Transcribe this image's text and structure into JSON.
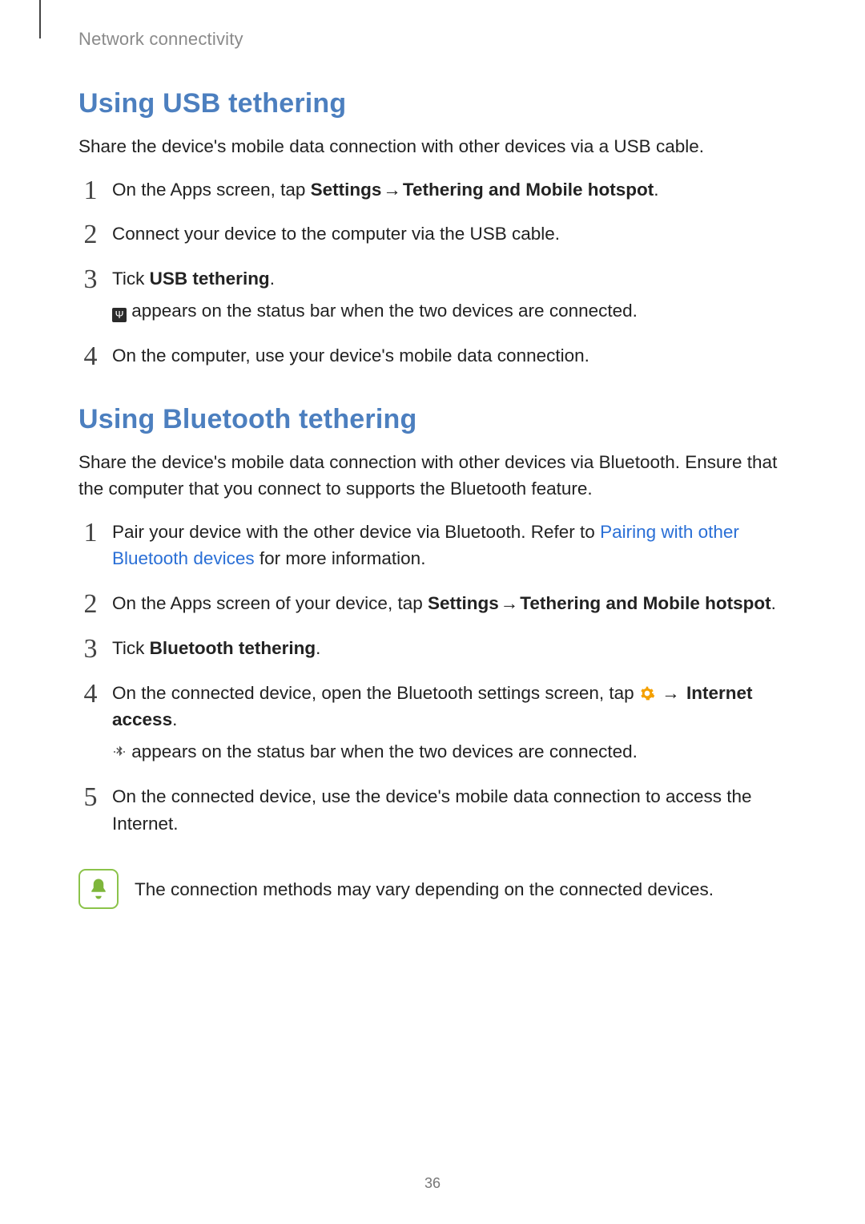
{
  "breadcrumb": "Network connectivity",
  "usb": {
    "heading": "Using USB tethering",
    "intro": "Share the device's mobile data connection with other devices via a USB cable.",
    "step1_prefix": "On the Apps screen, tap ",
    "step1_b1": "Settings",
    "step1_b2": "Tethering and Mobile hotspot",
    "step2": "Connect your device to the computer via the USB cable.",
    "step3_prefix": "Tick ",
    "step3_b": "USB tethering",
    "step3_suffix": ".",
    "step3_sub": " appears on the status bar when the two devices are connected.",
    "step4": "On the computer, use your device's mobile data connection."
  },
  "bt": {
    "heading": "Using Bluetooth tethering",
    "intro": "Share the device's mobile data connection with other devices via Bluetooth. Ensure that the computer that you connect to supports the Bluetooth feature.",
    "step1_prefix": "Pair your device with the other device via Bluetooth. Refer to ",
    "step1_link": "Pairing with other Bluetooth devices",
    "step1_suffix": " for more information.",
    "step2_prefix": "On the Apps screen of your device, tap ",
    "step2_b1": "Settings",
    "step2_b2": "Tethering and Mobile hotspot",
    "step3_prefix": "Tick ",
    "step3_b": "Bluetooth tethering",
    "step3_suffix": ".",
    "step4_prefix": "On the connected device, open the Bluetooth settings screen, tap ",
    "step4_b": "Internet access",
    "step4_suffix": ".",
    "step4_sub": " appears on the status bar when the two devices are connected.",
    "step5": "On the connected device, use the device's mobile data connection to access the Internet."
  },
  "note": "The connection methods may vary depending on the connected devices.",
  "arrow": "→",
  "page_number": "36"
}
